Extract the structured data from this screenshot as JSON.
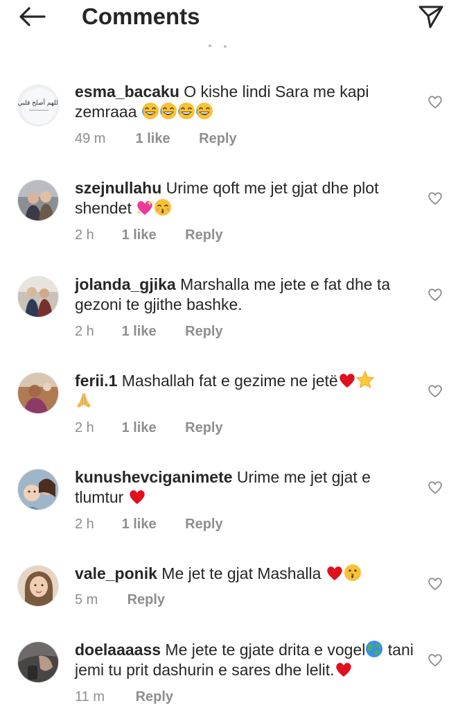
{
  "header": {
    "title": "Comments",
    "back_icon": "arrow-left-icon",
    "share_icon": "paper-plane-icon"
  },
  "comments": [
    {
      "username": "esma_bacaku",
      "text": "O kishe lindi Sara me kapi zemraaa",
      "emojis": [
        "grinning-sweat-face",
        "grinning-sweat-face",
        "grinning-sweat-face",
        "grinning-sweat-face"
      ],
      "time": "49 m",
      "likes": "1 like",
      "reply": "Reply",
      "avatar_text": "اللهم أصلح قلبي"
    },
    {
      "username": "szejnullahu",
      "text": "Urime qoft me jet gjat dhe plot shendet",
      "emojis": [
        "sparkling-heart",
        "kissing-face-closed-eyes"
      ],
      "time": "2 h",
      "likes": "1 like",
      "reply": "Reply"
    },
    {
      "username": "jolanda_gjika",
      "text": "Marshalla me jete e fat dhe ta gezoni te gjithe bashke.",
      "emojis": [],
      "time": "2 h",
      "likes": "1 like",
      "reply": "Reply"
    },
    {
      "username": "ferii.1",
      "text": "Mashallah  fat e gezime ne jetë",
      "emojis": [
        "red-heart",
        "star",
        "folded-hands"
      ],
      "time": "2 h",
      "likes": "1 like",
      "reply": "Reply"
    },
    {
      "username": "kunushevciganimete",
      "text": "Urime me jet gjat e tlumtur",
      "emojis": [
        "red-heart"
      ],
      "time": "2 h",
      "likes": "1 like",
      "reply": "Reply"
    },
    {
      "username": "vale_ponik",
      "text": "Me jet te gjat Mashalla",
      "emojis": [
        "red-heart",
        "kissing-face"
      ],
      "time": "5 m",
      "likes": "",
      "reply": "Reply"
    },
    {
      "username": "doelaaaass",
      "text": "Me jete te gjate drita e vogel",
      "text2": "tani jemi tu prit dashurin e sares dhe lelit.",
      "emojis": [
        "globe-icon"
      ],
      "emojis2": [
        "red-heart"
      ],
      "time": "11 m",
      "likes": "",
      "reply": "Reply"
    }
  ],
  "colors": {
    "text": "#262626",
    "muted": "#8e8e8e",
    "heart_red": "#e0101e",
    "heart_outline": "#8e8e8e"
  }
}
